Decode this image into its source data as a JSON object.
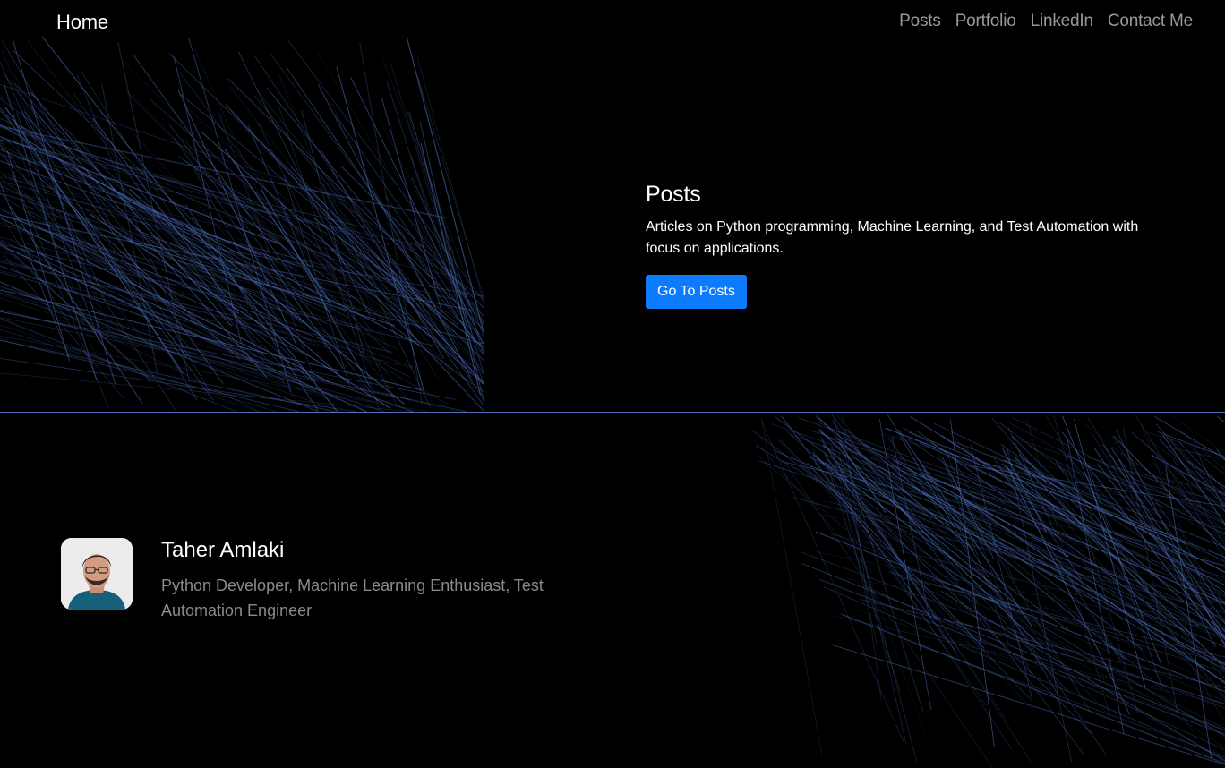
{
  "nav": {
    "brand": "Home",
    "links": [
      "Posts",
      "Portfolio",
      "LinkedIn",
      "Contact Me"
    ]
  },
  "hero": {
    "title": "Posts",
    "description": "Articles on Python programming, Machine Learning, and Test Automation with focus on applications.",
    "button_label": "Go To Posts"
  },
  "profile": {
    "name": "Taher Amlaki",
    "tagline": "Python Developer, Machine Learning Enthusiast, Test Automation Engineer"
  },
  "colors": {
    "background": "#000000",
    "accent": "#0d7bff",
    "lines": "#4b6fb8",
    "muted_text": "#8a8a8a"
  }
}
